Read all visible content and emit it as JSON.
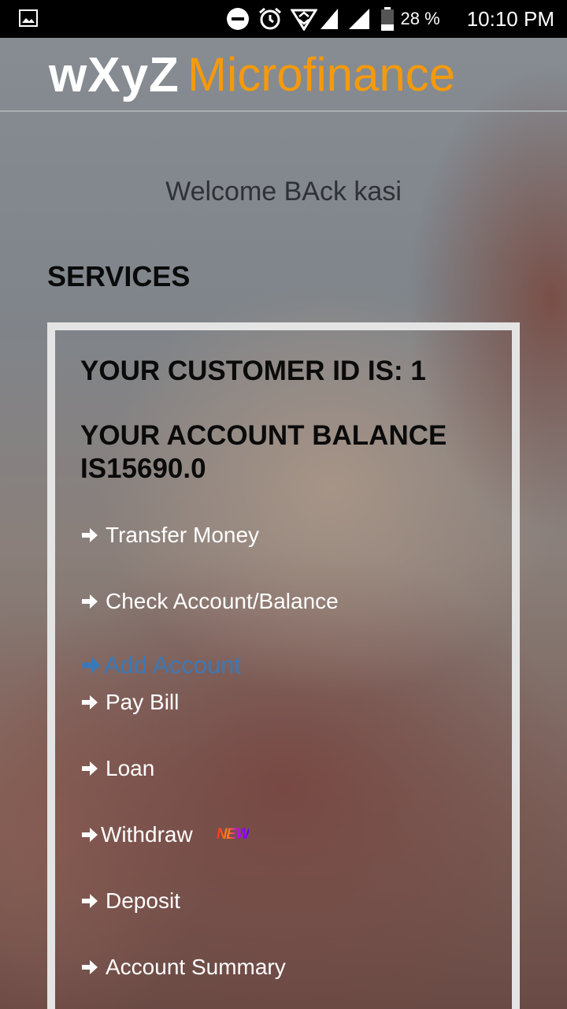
{
  "status_bar": {
    "battery": "28 %",
    "time": "10:10 PM",
    "icons": [
      "image-icon",
      "dnd-icon",
      "alarm-icon",
      "data-saver-icon",
      "signal-icon",
      "signal-icon-2",
      "battery-icon"
    ]
  },
  "header": {
    "brand_bold": "wXyZ",
    "brand_light": "Microfinance"
  },
  "welcome": "Welcome BAck kasi",
  "services_title": "SERVICES",
  "account": {
    "customer_id_line": "YOUR CUSTOMER ID IS: 1",
    "balance_line": "YOUR ACCOUNT BALANCE IS15690.0"
  },
  "menu": {
    "transfer": "Transfer Money",
    "check": "Check Account/Balance",
    "add": "Add Account",
    "paybill": "Pay Bill",
    "loan": "Loan",
    "withdraw": "Withdraw",
    "new_badge": "NEW",
    "deposit": "Deposit",
    "summary": "Account Summary"
  },
  "colors": {
    "brand_accent": "#f59a0c",
    "link_active": "#3a79b8",
    "menu_text": "#ffffff"
  }
}
